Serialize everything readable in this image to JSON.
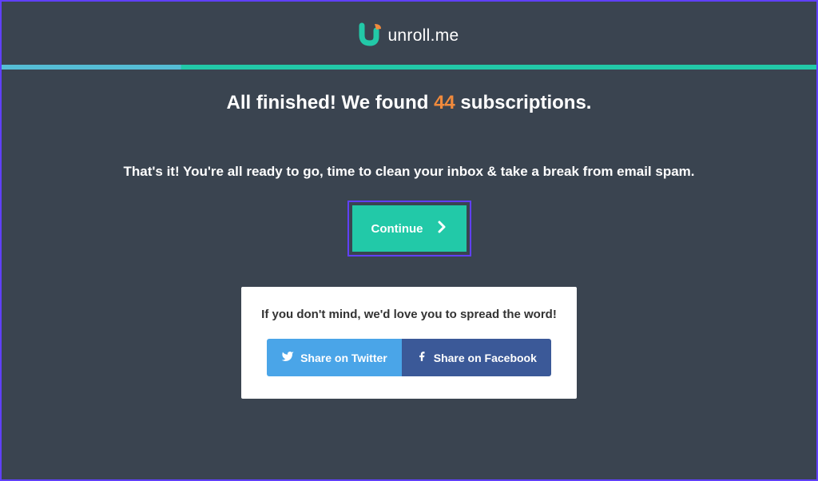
{
  "brand": {
    "name": "unroll.me"
  },
  "heading": {
    "prefix": "All finished! We found ",
    "count": "44",
    "suffix": " subscriptions."
  },
  "subheading": "That's it! You're all ready to go, time to clean your inbox & take a break from email spam.",
  "continue_label": "Continue",
  "share": {
    "prompt": "If you don't mind, we'd love you to spread the word!",
    "twitter_label": "Share on Twitter",
    "facebook_label": "Share on Facebook"
  },
  "colors": {
    "background": "#3a4450",
    "accent_teal": "#22c9a8",
    "accent_orange": "#f08a3c",
    "twitter": "#4aa5e8",
    "facebook": "#3b5998",
    "highlight_border": "#6040ff"
  }
}
